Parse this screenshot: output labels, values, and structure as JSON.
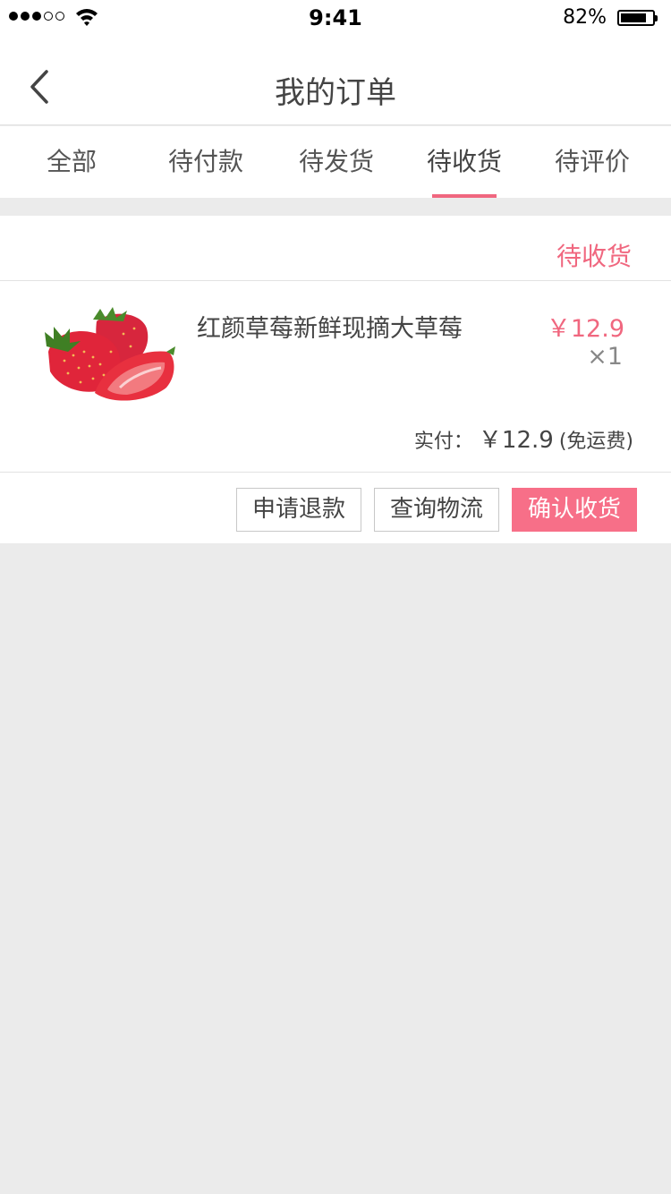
{
  "status_bar": {
    "time": "9:41",
    "battery": "82%",
    "battery_level": 0.82,
    "signal_bars_filled": 3,
    "signal_bars_total": 5
  },
  "header": {
    "title": "我的订单",
    "back_icon": "chevron-left-icon"
  },
  "tabs": [
    {
      "label": "全部",
      "active": false
    },
    {
      "label": "待付款",
      "active": false
    },
    {
      "label": "待发货",
      "active": false
    },
    {
      "label": "待收货",
      "active": true
    },
    {
      "label": "待评价",
      "active": false
    }
  ],
  "order": {
    "status": "待收货",
    "product": {
      "name": "红颜草莓新鲜现摘大草莓",
      "price": "￥12.9",
      "quantity": "×1",
      "image": "strawberries"
    },
    "payment": {
      "label": "实付：",
      "amount": "￥12.9",
      "note": "(免运费)"
    },
    "actions": {
      "refund": "申请退款",
      "logistics": "查询物流",
      "confirm": "确认收货"
    }
  },
  "colors": {
    "accent": "#f0677f",
    "primary_button": "#f76f88",
    "background": "#ebebeb"
  }
}
